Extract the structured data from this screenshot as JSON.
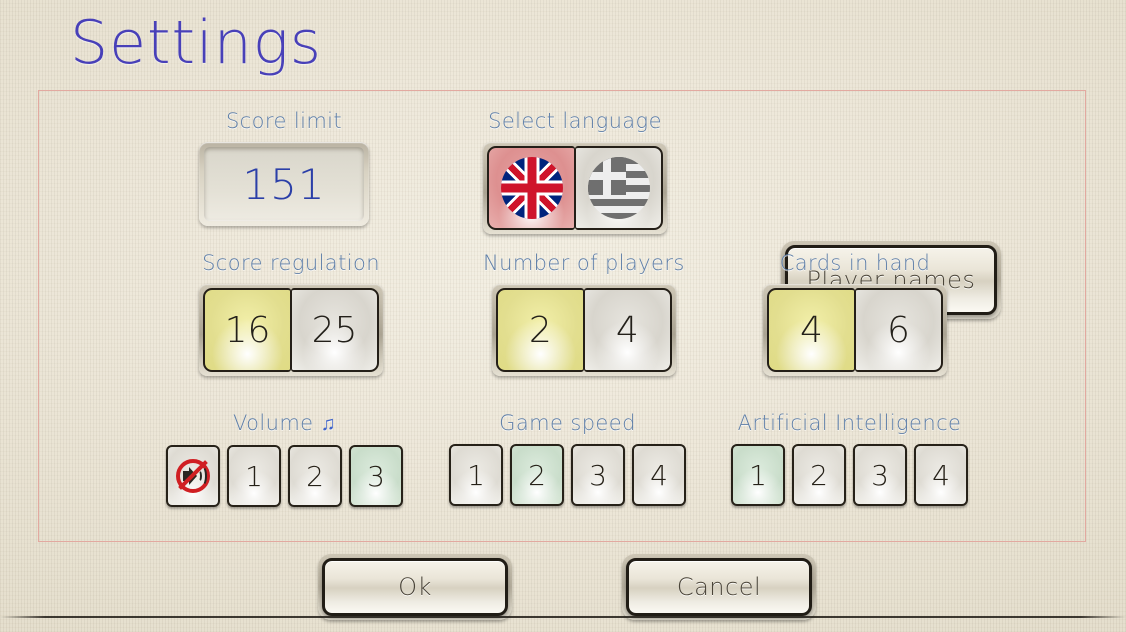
{
  "page": {
    "title": "Settings"
  },
  "settings": {
    "score_limit": {
      "label": "Score limit",
      "value": "151"
    },
    "select_language": {
      "label": "Select language",
      "options": [
        {
          "name": "english",
          "icon": "uk-flag-icon",
          "selected": true
        },
        {
          "name": "greek",
          "icon": "greek-flag-icon",
          "selected": false
        }
      ]
    },
    "player_names": {
      "label": "Player names"
    },
    "score_regulation": {
      "label": "Score regulation",
      "options": [
        "16",
        "25"
      ],
      "selected": "16"
    },
    "number_of_players": {
      "label": "Number of players",
      "options": [
        "2",
        "4"
      ],
      "selected": "2"
    },
    "cards_in_hand": {
      "label": "Cards in hand",
      "options": [
        "4",
        "6"
      ],
      "selected": "4"
    },
    "volume": {
      "label": "Volume",
      "note_icon": "♫",
      "options": [
        "mute",
        "1",
        "2",
        "3"
      ],
      "selected": "3"
    },
    "game_speed": {
      "label": "Game speed",
      "options": [
        "1",
        "2",
        "3",
        "4"
      ],
      "selected": "2"
    },
    "artificial_intelligence": {
      "label": "Artificial Intelligence",
      "options": [
        "1",
        "2",
        "3",
        "4"
      ],
      "selected": "1"
    }
  },
  "actions": {
    "ok": "Ok",
    "cancel": "Cancel"
  },
  "colors": {
    "title": "#4840b8",
    "label": "#5f7fa8",
    "value": "#2b3fa8",
    "frame_border": "#e2a9a0",
    "selected_yellow": "#e2de8f",
    "selected_green": "#cfe0cf",
    "mute_red": "#d01f23"
  }
}
